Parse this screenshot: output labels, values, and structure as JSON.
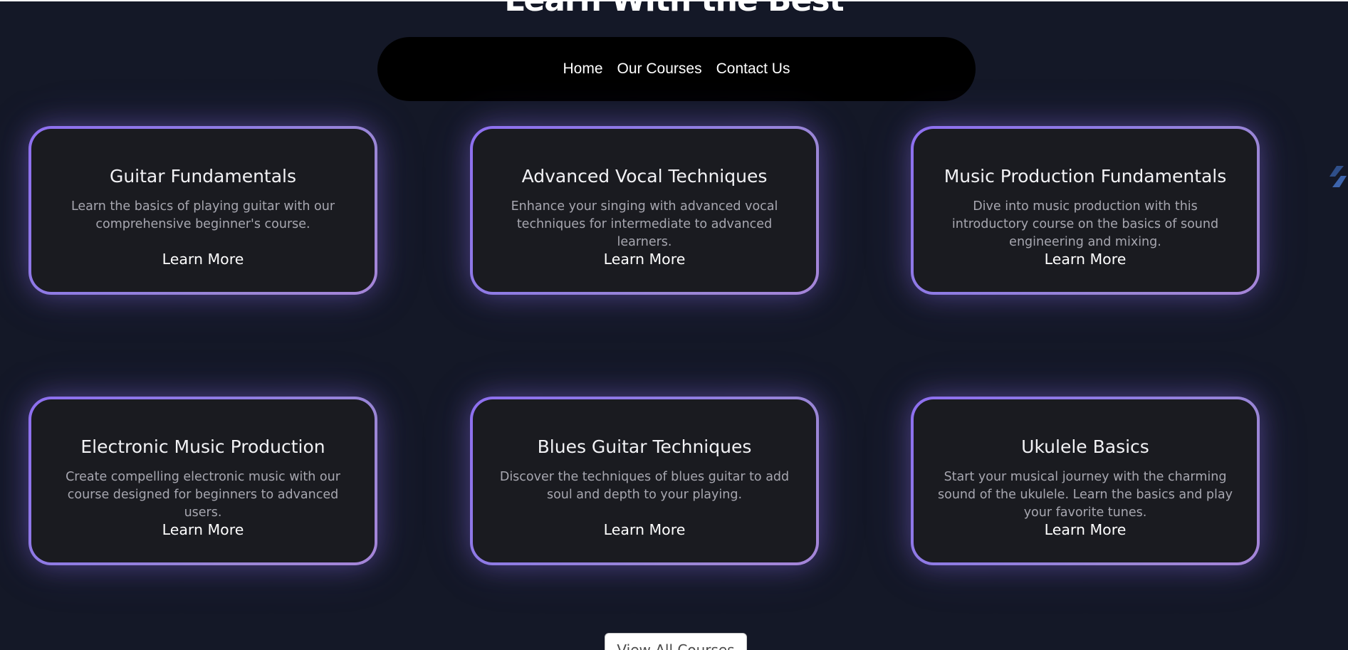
{
  "page": {
    "title": "Learn With the Best"
  },
  "nav": {
    "items": [
      {
        "label": "Home"
      },
      {
        "label": "Our Courses"
      },
      {
        "label": "Contact Us"
      }
    ]
  },
  "courses": [
    {
      "title": "Guitar Fundamentals",
      "description": "Learn the basics of playing guitar with our comprehensive beginner's course.",
      "link_label": "Learn More"
    },
    {
      "title": "Advanced Vocal Techniques",
      "description": "Enhance your singing with advanced vocal techniques for intermediate to advanced learners.",
      "link_label": "Learn More"
    },
    {
      "title": "Music Production Fundamentals",
      "description": "Dive into music production with this introductory course on the basics of sound engineering and mixing.",
      "link_label": "Learn More"
    },
    {
      "title": "Electronic Music Production",
      "description": "Create compelling electronic music with our course designed for beginners to advanced users.",
      "link_label": "Learn More"
    },
    {
      "title": "Blues Guitar Techniques",
      "description": "Discover the techniques of blues guitar to add soul and depth to your playing.",
      "link_label": "Learn More"
    },
    {
      "title": "Ukulele Basics",
      "description": "Start your musical journey with the charming sound of the ukulele. Learn the basics and play your favorite tunes.",
      "link_label": "Learn More"
    }
  ],
  "view_all": {
    "label": "View All Courses"
  },
  "icons": {
    "side": "floating-widget-icon"
  },
  "colors": {
    "background": "#141827",
    "card_border_accent": "#8e6ff0",
    "card_fill": "#1a1b20",
    "nav_fill": "#000000"
  }
}
